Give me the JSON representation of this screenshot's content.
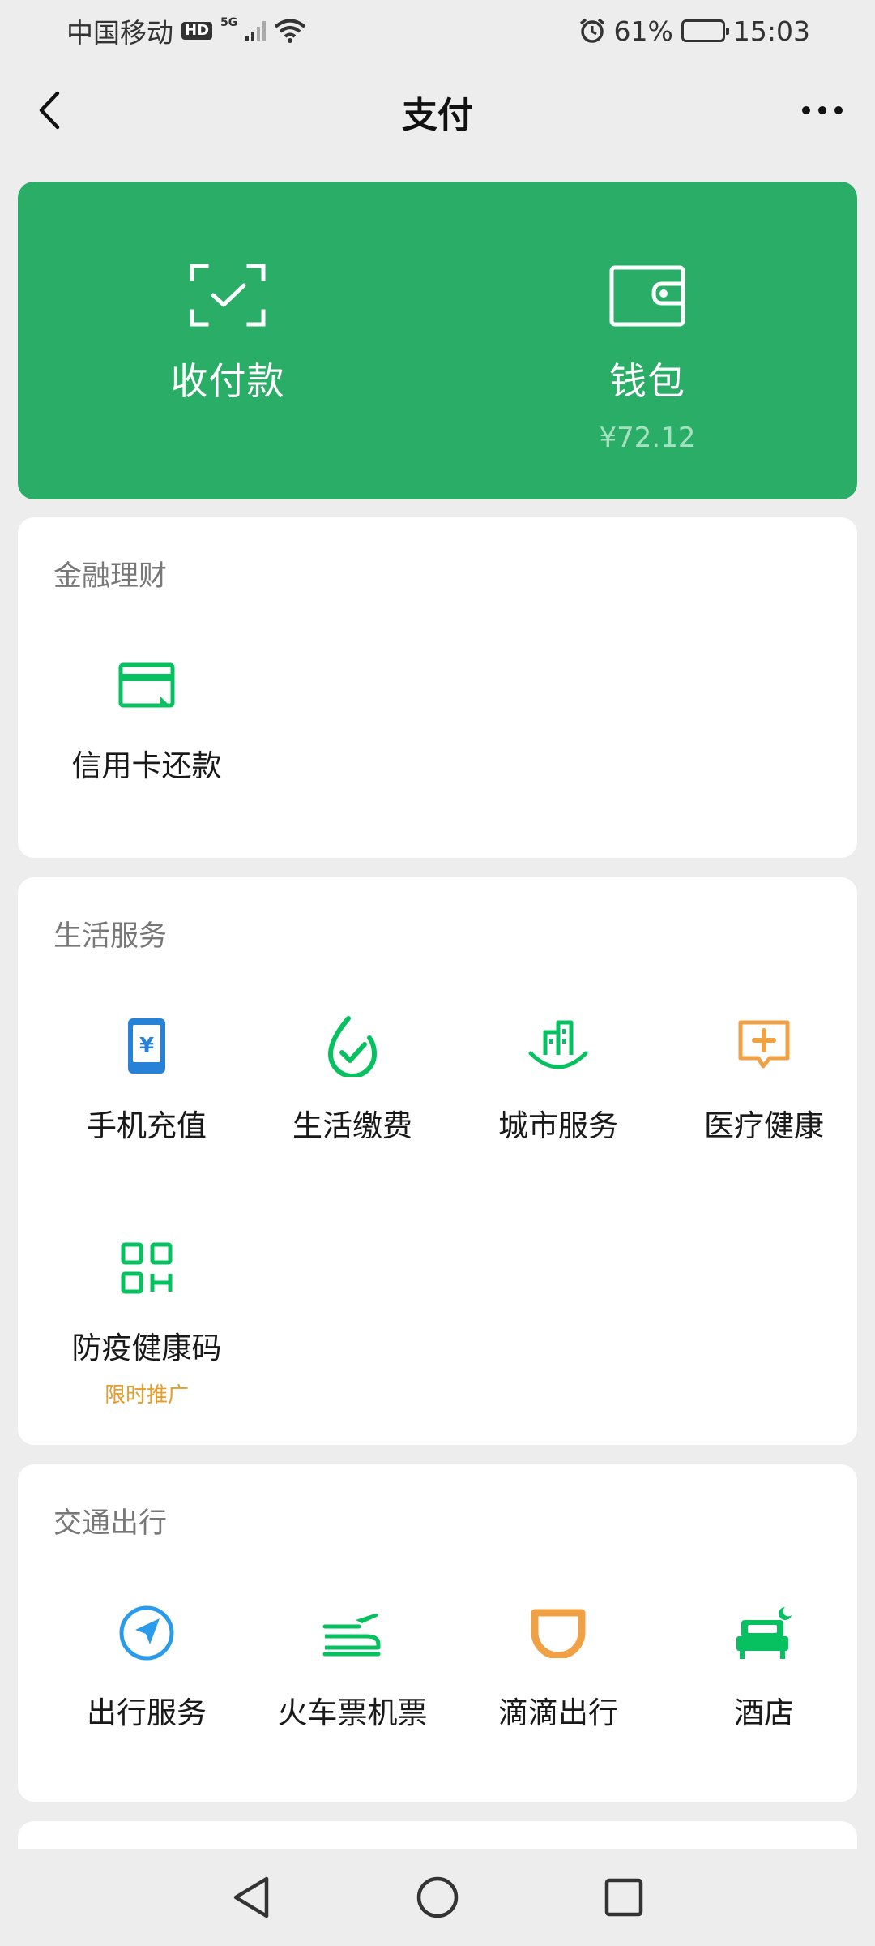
{
  "status_bar": {
    "carrier": "中国移动",
    "hd": "HD",
    "network": "5G",
    "battery": "61%",
    "battery_level": 0.61,
    "time": "15:03"
  },
  "header": {
    "title": "支付"
  },
  "green_card": {
    "items": [
      {
        "label": "收付款",
        "icon": "scan-qr-icon"
      },
      {
        "label": "钱包",
        "icon": "wallet-icon",
        "sub": "¥72.12"
      }
    ],
    "color": "#2aae67"
  },
  "sections": {
    "finance": {
      "title": "金融理财",
      "items": [
        {
          "label": "信用卡还款",
          "icon": "credit-card-icon"
        }
      ]
    },
    "life": {
      "title": "生活服务",
      "items": [
        {
          "label": "手机充值",
          "icon": "phone-recharge-icon"
        },
        {
          "label": "生活缴费",
          "icon": "utility-bill-icon"
        },
        {
          "label": "城市服务",
          "icon": "city-service-icon"
        },
        {
          "label": "医疗健康",
          "icon": "medical-icon"
        },
        {
          "label": "防疫健康码",
          "icon": "health-code-icon",
          "promo": "限时推广"
        }
      ]
    },
    "travel": {
      "title": "交通出行",
      "items": [
        {
          "label": "出行服务",
          "icon": "navigation-icon"
        },
        {
          "label": "火车票机票",
          "icon": "train-plane-icon"
        },
        {
          "label": "滴滴出行",
          "icon": "didi-icon"
        },
        {
          "label": "酒店",
          "icon": "hotel-bed-icon"
        }
      ]
    }
  },
  "colors": {
    "accent_green": "#2aae67",
    "icon_green": "#07c160",
    "icon_blue": "#2782d7",
    "icon_orange": "#f0a146",
    "promo_orange": "#e89c2a"
  }
}
